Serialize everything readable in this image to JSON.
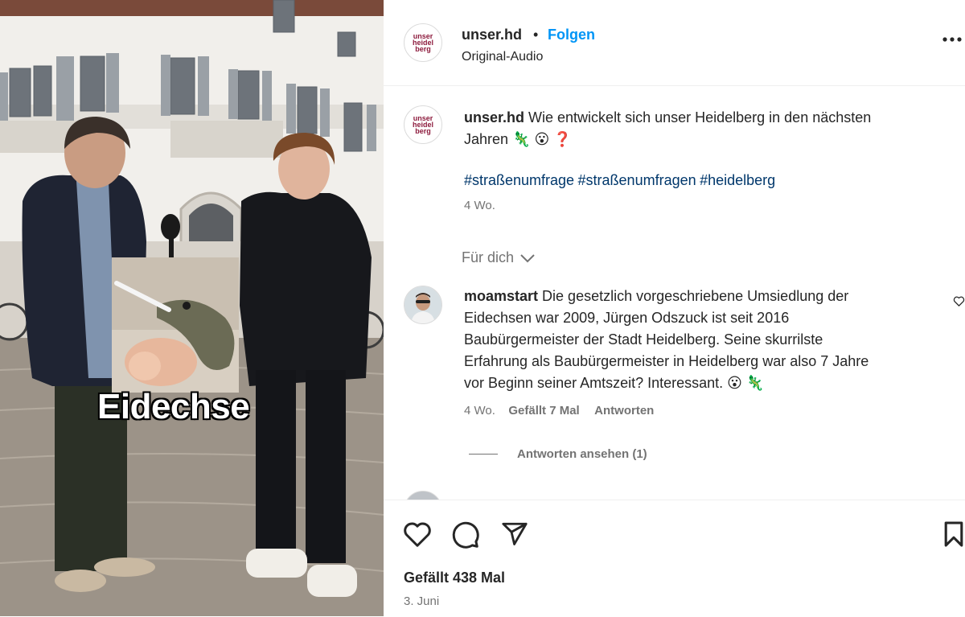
{
  "media": {
    "overlay_text": "Eidechse"
  },
  "header": {
    "account": "unser.hd",
    "separator": "•",
    "follow_label": "Folgen",
    "audio": "Original-Audio",
    "logo_lines": [
      "unser",
      "heidel",
      "berg"
    ],
    "more_label": "•••"
  },
  "caption": {
    "username": "unser.hd",
    "text": "Wie entwickelt sich unser Heidelberg in den nächsten",
    "text_line2": "Jahren 🦎 😮 ❓",
    "hashtags": [
      "#straßenumfrage",
      "#straßenumfragen",
      "#heidelberg"
    ],
    "time": "4 Wo."
  },
  "for_you": {
    "label": "Für dich"
  },
  "comment": {
    "username": "moamstart",
    "lines": [
      "Die gesetzlich vorgeschriebene Umsiedlung der",
      "Eidechsen war 2009, Jürgen Odszuck ist seit 2016",
      "Baubürgermeister der Stadt Heidelberg. Seine skurrilste",
      "Erfahrung als Baubürgermeister in Heidelberg war also 7 Jahre",
      "vor Beginn seiner Amtszeit? Interessant. 😮 🦎"
    ],
    "time": "4 Wo.",
    "likes": "Gefällt 7 Mal",
    "reply_label": "Antworten",
    "view_replies": "Antworten ansehen (1)"
  },
  "footer": {
    "likes": "Gefällt 438 Mal",
    "date": "3. Juni"
  },
  "colors": {
    "brand": "#8d1b3d",
    "link": "#0095f6",
    "hashtag": "#00376b",
    "muted": "#737373"
  },
  "icons": [
    "heart-icon",
    "comment-icon",
    "share-icon",
    "bookmark-icon",
    "chevron-down-icon",
    "more-icon"
  ]
}
